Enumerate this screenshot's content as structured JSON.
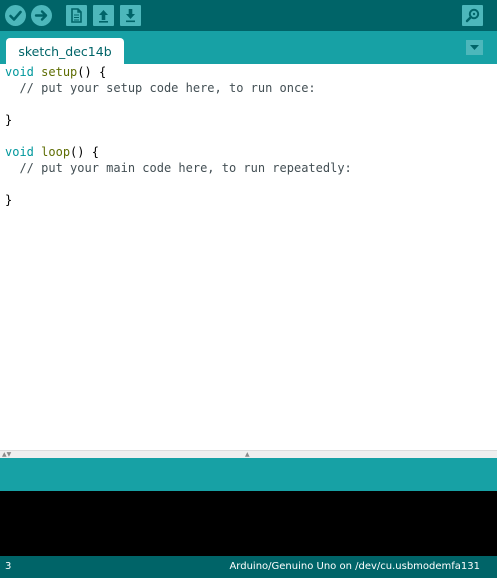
{
  "toolbar": {
    "buttons": [
      {
        "name": "verify",
        "icon": "checkmark-icon"
      },
      {
        "name": "upload",
        "icon": "arrow-right-icon"
      },
      {
        "name": "new",
        "icon": "new-file-icon"
      },
      {
        "name": "open",
        "icon": "arrow-up-icon"
      },
      {
        "name": "save",
        "icon": "arrow-down-icon"
      },
      {
        "name": "serial-monitor",
        "icon": "magnifier-icon"
      }
    ]
  },
  "tabs": {
    "active_label": "sketch_dec14b",
    "menu_icon": "triangle-down-icon"
  },
  "editor": {
    "lines": [
      {
        "kw": "void",
        "fn": "setup",
        "rest": "() {"
      },
      {
        "comment": "  // put your setup code here, to run once:"
      },
      {
        "text": ""
      },
      {
        "text": "}"
      },
      {
        "text": ""
      },
      {
        "kw": "void",
        "fn": "loop",
        "rest": "() {"
      },
      {
        "comment": "  // put your main code here, to run repeatedly:"
      },
      {
        "text": ""
      },
      {
        "text": "}"
      }
    ]
  },
  "status": {
    "line_number": "3",
    "board": "Arduino/Genuino Uno on /dev/cu.usbmodemfa131"
  },
  "colors": {
    "toolbar": "#006468",
    "tabbar": "#17a1a5",
    "button": "#4db7bb",
    "keyword": "#00979c",
    "function": "#5e6d03",
    "comment": "#434f54",
    "console": "#000000"
  }
}
